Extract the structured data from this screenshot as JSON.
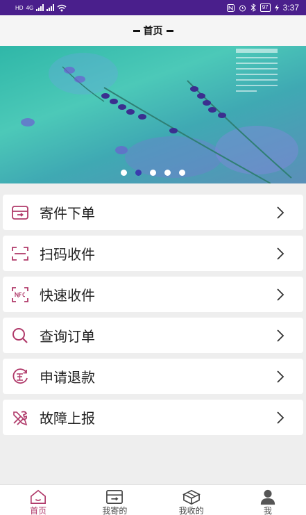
{
  "status_bar": {
    "net_a": "HD",
    "net_b": "4G",
    "battery": "97",
    "time": "3:37"
  },
  "header": {
    "title": "首页"
  },
  "banner": {
    "slide_count": 5,
    "active_index": 1
  },
  "menu": {
    "items": [
      {
        "label": "寄件下单",
        "icon": "send-package-icon"
      },
      {
        "label": "扫码收件",
        "icon": "scan-icon"
      },
      {
        "label": "快速收件",
        "icon": "nfc-icon"
      },
      {
        "label": "查询订单",
        "icon": "search-icon"
      },
      {
        "label": "申请退款",
        "icon": "refund-icon"
      },
      {
        "label": "故障上报",
        "icon": "tools-icon"
      }
    ]
  },
  "tab_bar": {
    "tabs": [
      {
        "label": "首页",
        "icon": "home-icon",
        "active": true
      },
      {
        "label": "我寄的",
        "icon": "outbox-icon",
        "active": false
      },
      {
        "label": "我收的",
        "icon": "package-icon",
        "active": false
      },
      {
        "label": "我",
        "icon": "user-icon",
        "active": false
      }
    ]
  },
  "colors": {
    "status_bar": "#4a1f8c",
    "accent": "#b03a6a",
    "dot_active": "#3a3cae"
  }
}
